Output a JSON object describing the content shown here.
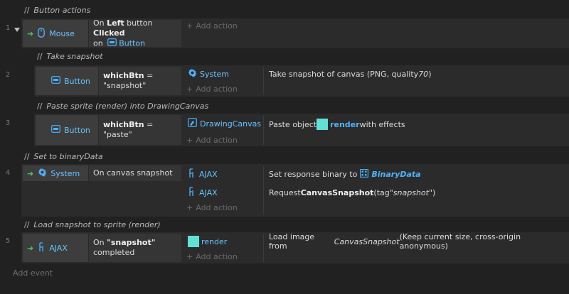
{
  "comments": {
    "c1": "Button actions",
    "c2": "Take snapshot",
    "c3": "Paste sprite (render) into DrawingCanvas",
    "c4": "Set to binaryData",
    "c5": "Load snapshot to sprite (render)"
  },
  "event_numbers": [
    "1",
    "2",
    "3",
    "4",
    "5"
  ],
  "comment_prefix": "//",
  "add_action": "Add action",
  "add_event": "Add event",
  "events": {
    "e1": {
      "object": "Mouse",
      "cond_pre": "On ",
      "cond_b1": "Left",
      "cond_mid": " button ",
      "cond_b2": "Clicked",
      "cond_on": "on",
      "cond_obj": "Button"
    },
    "e2": {
      "object": "Button",
      "cond_b": "whichBtn",
      "cond_rest1": " =",
      "cond_rest2": "\"snapshot\"",
      "act_obj": "System",
      "act_text_pre": "Take snapshot of canvas (PNG, quality ",
      "act_text_it": "70",
      "act_text_post": ")"
    },
    "e3": {
      "object": "Button",
      "cond_b": "whichBtn",
      "cond_rest": " = \"paste\"",
      "act_obj": "DrawingCanvas",
      "act_pre": "Paste object ",
      "act_obj2": "render",
      "act_post": " with effects"
    },
    "e4": {
      "object": "System",
      "cond": "On canvas snapshot",
      "act1_obj": "AJAX",
      "act1_pre": "Set response binary to ",
      "act1_val": "BinaryData",
      "act2_obj": "AJAX",
      "act2_pre": "Request ",
      "act2_b": "CanvasSnapshot",
      "act2_post": " (tag ",
      "act2_it": "\"snapshot\"",
      "act2_end": ")"
    },
    "e5": {
      "object": "AJAX",
      "cond_pre": "On ",
      "cond_b": "\"snapshot\"",
      "cond_post": "completed",
      "act_obj": "render",
      "act_pre": "Load image from ",
      "act_it": "CanvasSnapshot",
      "act_post": " (Keep current size, cross-origin anonymous)"
    }
  }
}
